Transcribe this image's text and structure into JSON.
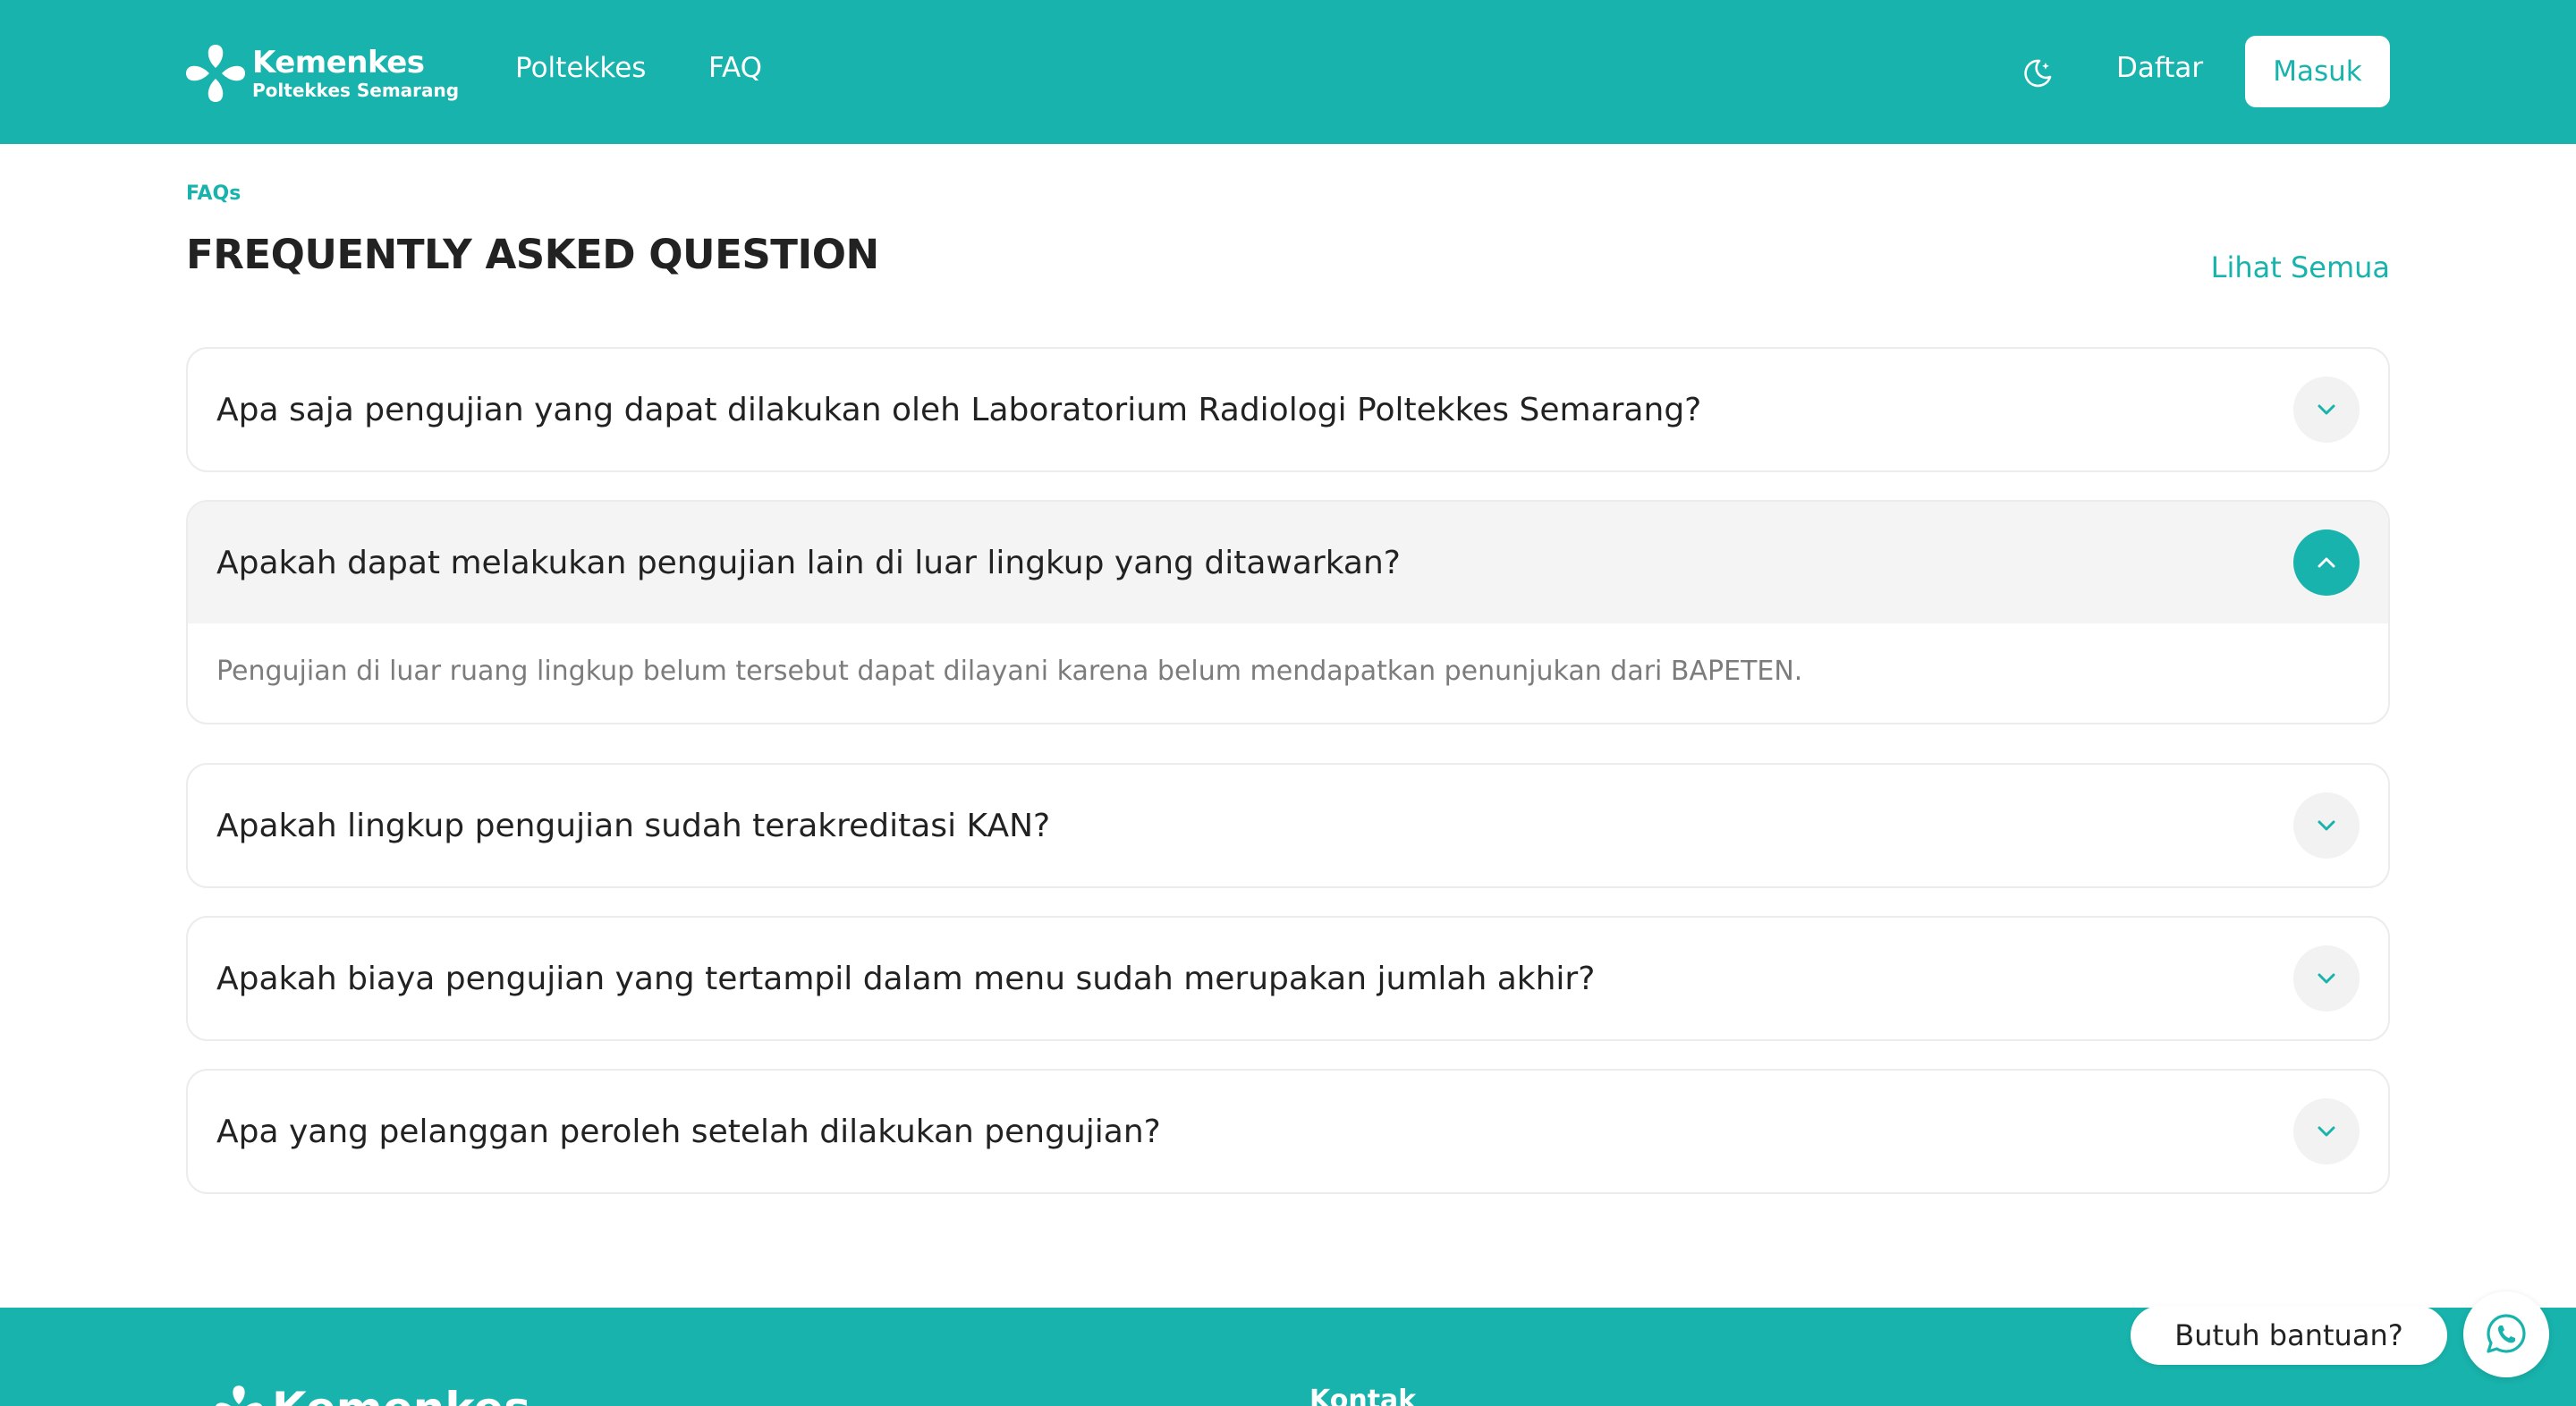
{
  "header": {
    "logo_title": "Kemenkes",
    "logo_subtitle": "Poltekkes Semarang",
    "nav": [
      "Poltekkes",
      "FAQ"
    ],
    "theme_icon": "moon-icon",
    "register_label": "Daftar",
    "login_label": "Masuk"
  },
  "faq_section": {
    "eyebrow": "FAQs",
    "title": "FREQUENTLY ASKED QUESTION",
    "see_all": "Lihat Semua",
    "items": [
      {
        "question": "Apa saja pengujian yang dapat dilakukan oleh Laboratorium Radiologi Poltekkes Semarang?",
        "expanded": false
      },
      {
        "question": "Apakah dapat melakukan pengujian lain di luar lingkup yang ditawarkan?",
        "expanded": true,
        "answer": "Pengujian di luar ruang lingkup belum tersebut dapat dilayani karena belum mendapatkan penunjukan dari BAPETEN."
      },
      {
        "question": "Apakah lingkup pengujian sudah terakreditasi KAN?",
        "expanded": false
      },
      {
        "question": "Apakah biaya pengujian yang tertampil dalam menu sudah merupakan jumlah akhir?",
        "expanded": false
      },
      {
        "question": "Apa yang pelanggan peroleh setelah dilakukan pengujian?",
        "expanded": false
      }
    ]
  },
  "footer": {
    "logo_text": "Kemenkes",
    "contact_heading": "Kontak"
  },
  "help": {
    "label": "Butuh bantuan?",
    "icon": "whatsapp-icon"
  },
  "colors": {
    "brand": "#18b3ac",
    "text": "#222222",
    "muted": "#7c7c7c"
  }
}
